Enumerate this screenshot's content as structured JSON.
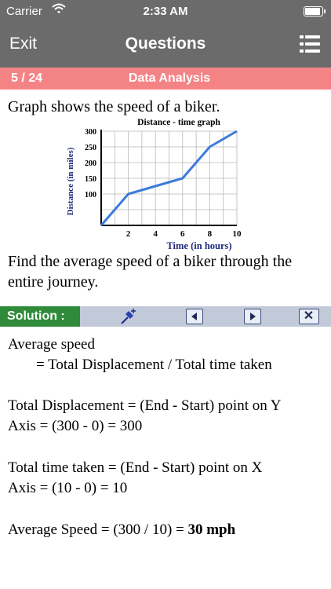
{
  "status_bar": {
    "carrier": "Carrier",
    "time": "2:33 AM",
    "battery_level_percent": 90
  },
  "nav_bar": {
    "exit_label": "Exit",
    "title": "Questions"
  },
  "section_bar": {
    "count": "5 / 24",
    "topic": "Data Analysis"
  },
  "question": {
    "intro": "Graph shows the speed of a biker.",
    "prompt_line1": "Find the average speed of a biker through the",
    "prompt_line2": "entire journey."
  },
  "chart_data": {
    "type": "line",
    "title": "Distance - time graph",
    "xlabel": "Time (in hours)",
    "ylabel": "Distance (in miles)",
    "x": [
      0,
      2,
      6,
      8,
      10
    ],
    "values": [
      0,
      100,
      150,
      250,
      300
    ],
    "xlim": [
      0,
      10
    ],
    "ylim": [
      0,
      300
    ],
    "x_ticks": [
      "2",
      "4",
      "6",
      "8",
      "10"
    ],
    "y_ticks": [
      "100",
      "150",
      "200",
      "250",
      "300"
    ],
    "grid": true,
    "line_color": "#3d7bd9"
  },
  "solution_bar": {
    "label": "Solution :"
  },
  "solution": {
    "line1": "Average speed",
    "line2": "= Total Displacement / Total time taken",
    "line3": "Total Displacement = (End - Start) point on Y",
    "line4": "Axis = (300 - 0) = 300",
    "line5": "Total time taken = (End - Start) point on X",
    "line6": "Axis = (10 - 0) = 10",
    "line7_prefix": "Average Speed = (300 / 10) = ",
    "line7_answer": "30 mph"
  },
  "colors": {
    "header_gray": "#6b6b6b",
    "section_pink": "#f48385",
    "solution_green": "#2f8b3a",
    "solution_bar_blue": "#c2c9d8",
    "axis_navy": "#1f2a7a"
  },
  "icons": {
    "wifi": "wifi-icon",
    "menu": "list-menu-icon",
    "pin": "pushpin-icon",
    "prev": "triangle-left-icon",
    "next": "triangle-right-icon",
    "close": "close-icon"
  }
}
